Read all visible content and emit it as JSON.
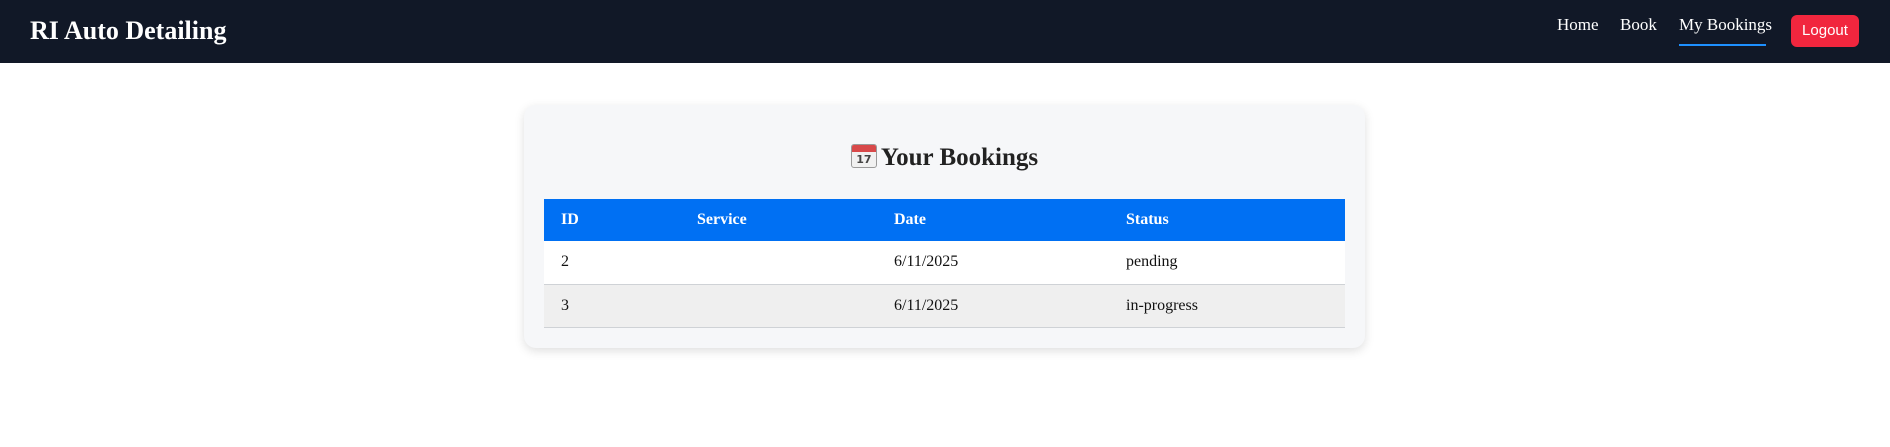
{
  "brand": "RI Auto Detailing",
  "nav": {
    "home": "Home",
    "book": "Book",
    "my_bookings": "My Bookings",
    "active": "My Bookings",
    "logout": "Logout"
  },
  "colors": {
    "navbar_bg": "#111827",
    "active_underline": "#1e90ff",
    "logout_bg": "#f1263e",
    "table_header_bg": "#0070f3"
  },
  "bookings": {
    "title_icon": "calendar-icon",
    "calendar_day": "17",
    "title": "Your Bookings",
    "columns": [
      "ID",
      "Service",
      "Date",
      "Status"
    ],
    "rows": [
      {
        "id": "2",
        "service": "",
        "date": "6/11/2025",
        "status": "pending"
      },
      {
        "id": "3",
        "service": "",
        "date": "6/11/2025",
        "status": "in-progress"
      }
    ]
  }
}
